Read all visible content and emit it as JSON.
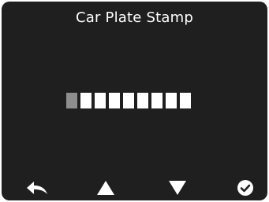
{
  "screen": {
    "title": "Car Plate Stamp"
  },
  "plate": {
    "slot_count": 9,
    "active_index": 0,
    "slot_color": "#ffffff",
    "active_slot_color": "#8e8e8e"
  },
  "softkeys": [
    {
      "icon": "back-arrow-icon"
    },
    {
      "icon": "triangle-up-icon"
    },
    {
      "icon": "triangle-down-icon"
    },
    {
      "icon": "check-circle-icon"
    }
  ],
  "colors": {
    "background": "#1f1f1f",
    "foreground": "#ffffff"
  }
}
